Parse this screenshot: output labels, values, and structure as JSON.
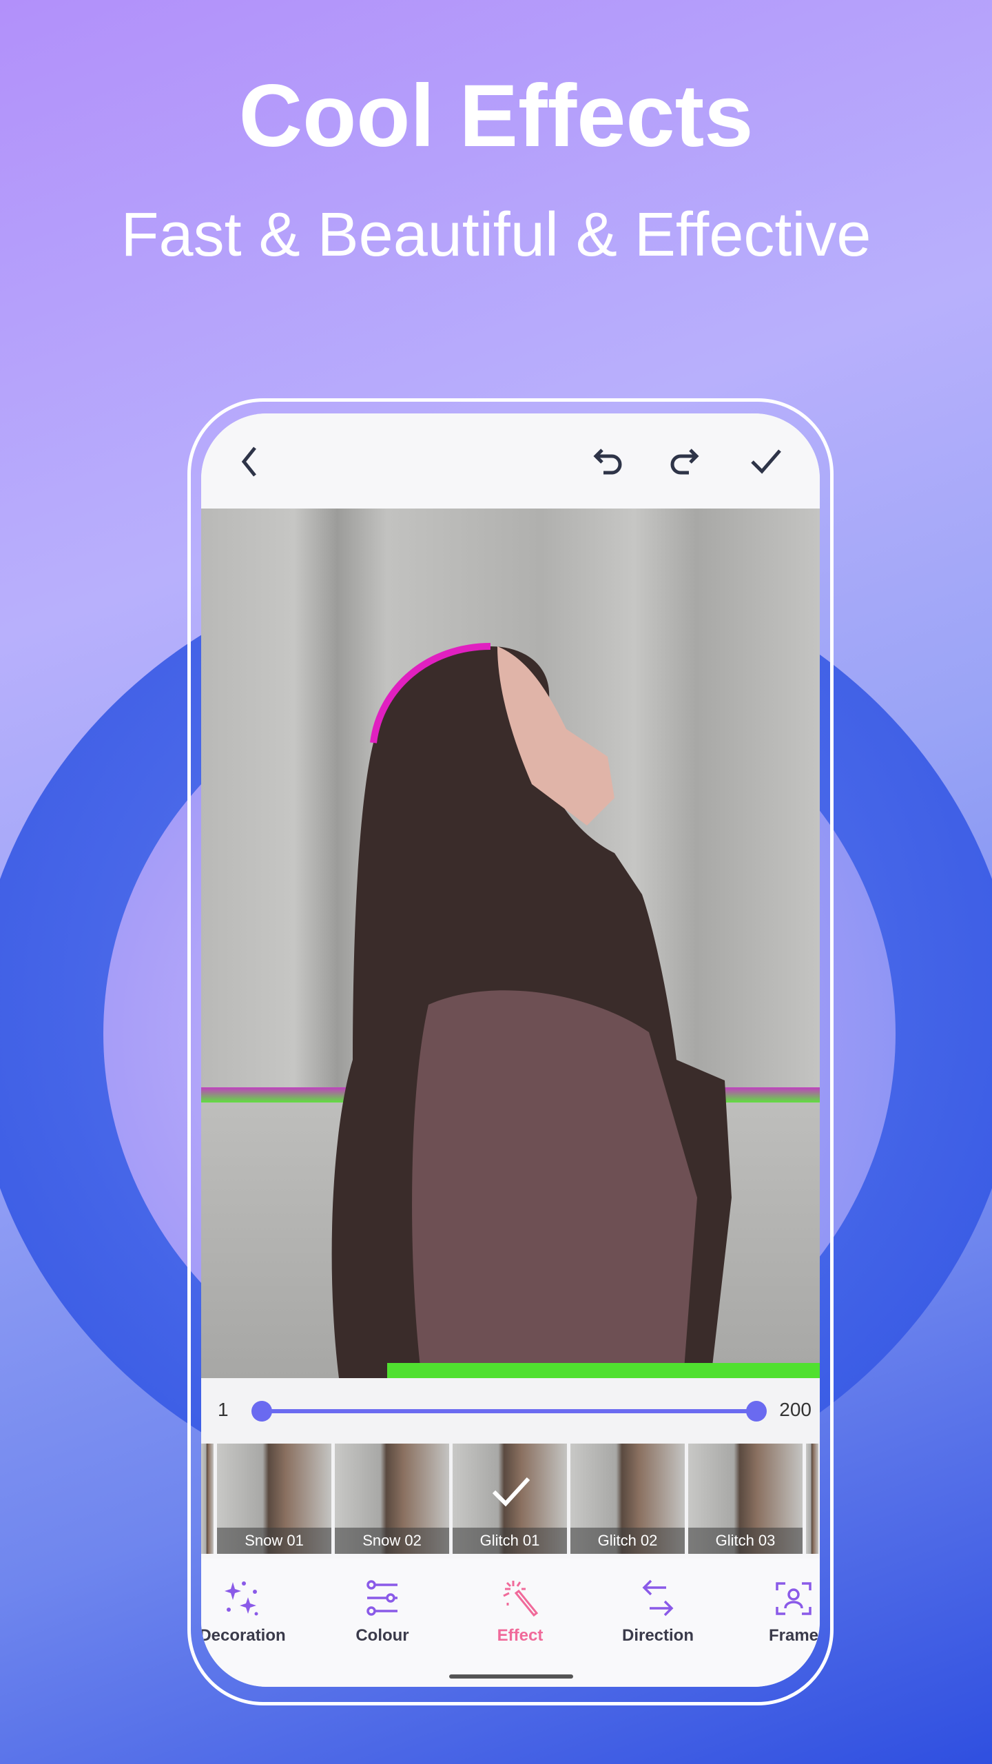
{
  "headline": {
    "title": "Cool Effects",
    "subtitle": "Fast & Beautiful & Effective"
  },
  "colors": {
    "accent": "#6a6af0",
    "active_tab": "#f06a9a",
    "icon": "#8a5ae8"
  },
  "header": {
    "icons": [
      "back-icon",
      "undo-icon",
      "redo-icon",
      "check-icon"
    ]
  },
  "slider": {
    "min": "1",
    "max": "200",
    "low_value": 1,
    "high_value": 200
  },
  "effects": [
    {
      "label": "Snow 01"
    },
    {
      "label": "Snow 02"
    },
    {
      "label": "Glitch 01",
      "selected": true
    },
    {
      "label": "Glitch 02"
    },
    {
      "label": "Glitch 03"
    }
  ],
  "nav": [
    {
      "label": "Decoration",
      "icon": "sparkles-icon"
    },
    {
      "label": "Colour",
      "icon": "sliders-icon"
    },
    {
      "label": "Effect",
      "icon": "magic-wand-icon",
      "active": true
    },
    {
      "label": "Direction",
      "icon": "arrows-swap-icon"
    },
    {
      "label": "Frame",
      "icon": "frame-person-icon"
    }
  ]
}
